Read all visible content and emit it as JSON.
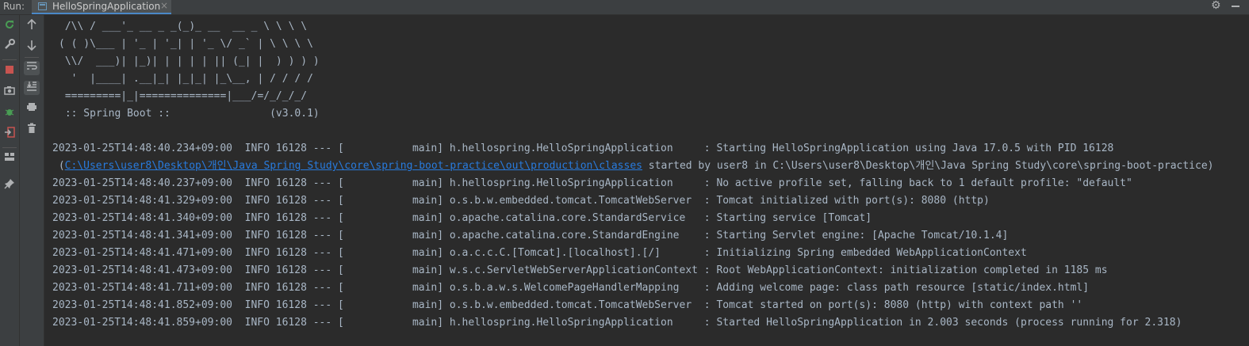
{
  "run_panel": {
    "label": "Run:",
    "tab_title": "HelloSpringApplication",
    "tab_close": "×"
  },
  "toolbar": {
    "rerun_icon": "rerun-icon",
    "settings_icon": "wrench-icon",
    "stop_icon": "stop-icon",
    "screenshot_icon": "camera-icon",
    "debug_icon": "bug-icon",
    "exit_icon": "exit-icon",
    "layout_icon": "layout-icon",
    "pin_icon": "pin-icon",
    "up_icon": "arrow-up-icon",
    "down_icon": "arrow-down-icon",
    "wrap_icon": "soft-wrap-icon",
    "scroll_icon": "scroll-to-end-icon",
    "print_icon": "print-icon",
    "trash_icon": "trash-icon"
  },
  "console": {
    "banner": [
      " /\\\\ / ___'_ __ _ _(_)_ __  __ _ \\ \\ \\ \\",
      "( ( )\\___ | '_ | '_| | '_ \\/ _` | \\ \\ \\ \\",
      " \\\\/  ___)| |_)| | | | | || (_| |  ) ) ) )",
      "  '  |____| .__|_| |_|_| |_\\__, | / / / /",
      " =========|_|==============|___/=/_/_/_/",
      " :: Spring Boot ::                (v3.0.1)"
    ],
    "log_lines": [
      "2023-01-25T14:48:40.234+09:00  INFO 16128 --- [           main] h.hellospring.HelloSpringApplication     : Starting HelloSpringApplication using Java 17.0.5 with PID 16128",
      "2023-01-25T14:48:40.237+09:00  INFO 16128 --- [           main] h.hellospring.HelloSpringApplication     : No active profile set, falling back to 1 default profile: \"default\"",
      "2023-01-25T14:48:41.329+09:00  INFO 16128 --- [           main] o.s.b.w.embedded.tomcat.TomcatWebServer  : Tomcat initialized with port(s): 8080 (http)",
      "2023-01-25T14:48:41.340+09:00  INFO 16128 --- [           main] o.apache.catalina.core.StandardService   : Starting service [Tomcat]",
      "2023-01-25T14:48:41.341+09:00  INFO 16128 --- [           main] o.apache.catalina.core.StandardEngine    : Starting Servlet engine: [Apache Tomcat/10.1.4]",
      "2023-01-25T14:48:41.471+09:00  INFO 16128 --- [           main] o.a.c.c.C.[Tomcat].[localhost].[/]       : Initializing Spring embedded WebApplicationContext",
      "2023-01-25T14:48:41.473+09:00  INFO 16128 --- [           main] w.s.c.ServletWebServerApplicationContext : Root WebApplicationContext: initialization completed in 1185 ms",
      "2023-01-25T14:48:41.711+09:00  INFO 16128 --- [           main] o.s.b.a.w.s.WelcomePageHandlerMapping    : Adding welcome page: class path resource [static/index.html]",
      "2023-01-25T14:48:41.852+09:00  INFO 16128 --- [           main] o.s.b.w.embedded.tomcat.TomcatWebServer  : Tomcat started on port(s): 8080 (http) with context path ''",
      "2023-01-25T14:48:41.859+09:00  INFO 16128 --- [           main] h.hellospring.HelloSpringApplication     : Started HelloSpringApplication in 2.003 seconds (process running for 2.318)"
    ],
    "path_line": {
      "prefix": " (",
      "link": "C:\\Users\\user8\\Desktop\\개인\\Java Spring Study\\core\\spring-boot-practice\\out\\production\\classes",
      "suffix": " started by user8 in C:\\Users\\user8\\Desktop\\개인\\Java Spring Study\\core\\spring-boot-practice)"
    }
  },
  "colors": {
    "background": "#2b2b2b",
    "text": "#a9b7c6",
    "link": "#287bde",
    "stop": "#c75450",
    "rerun": "#499c54"
  }
}
